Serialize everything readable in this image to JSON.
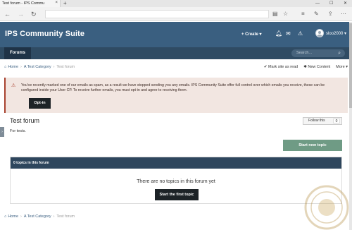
{
  "browser": {
    "tab_title": "Test forum - IPS Commu",
    "tab_close": "×",
    "new_tab": "+",
    "minimize": "—",
    "maximize": "☐",
    "close": "✕",
    "icons": [
      "back-icon",
      "forward-icon",
      "refresh-icon",
      "reader-view-icon",
      "favorite-star-icon",
      "hub-icon",
      "pen-icon",
      "share-icon",
      "more-icon"
    ]
  },
  "header": {
    "site_title": "IPS Community Suite",
    "create_label": "+ Create ▾",
    "username": "sloo2000 ▾"
  },
  "nav": {
    "forums_label": "Forums",
    "search_placeholder": "Search..."
  },
  "breadcrumb": {
    "home": "Home",
    "category": "A Test Category",
    "current": "Test forum",
    "mark_read": "Mark site as read",
    "new_content": "New Content",
    "more": "More"
  },
  "notice": {
    "text": "You've recently marked one of our emails as spam, as a result we have stopped sending you any emails. IPS Community Suite offer full control over which emails you receive, these can be configured inside your User CP. To receive further emails, you must opt-in and agree to receiving them.",
    "optin_label": "Opt-in"
  },
  "forum": {
    "title": "Test forum",
    "follow_label": "Follow this",
    "follow_count": "0",
    "description": "For tests.",
    "start_topic_label": "Start new topic",
    "topics_header": "0 topics in this forum",
    "empty_message": "There are no topics in this forum yet",
    "start_first_label": "Start the first topic"
  },
  "colors": {
    "header_bg": "#3a5f80",
    "nav_bg": "#2f4b63",
    "notice_bg": "#f2e6e1",
    "notice_accent": "#a8412f",
    "start_topic_bg": "#6f9b85",
    "dark_button": "#1d2327"
  }
}
